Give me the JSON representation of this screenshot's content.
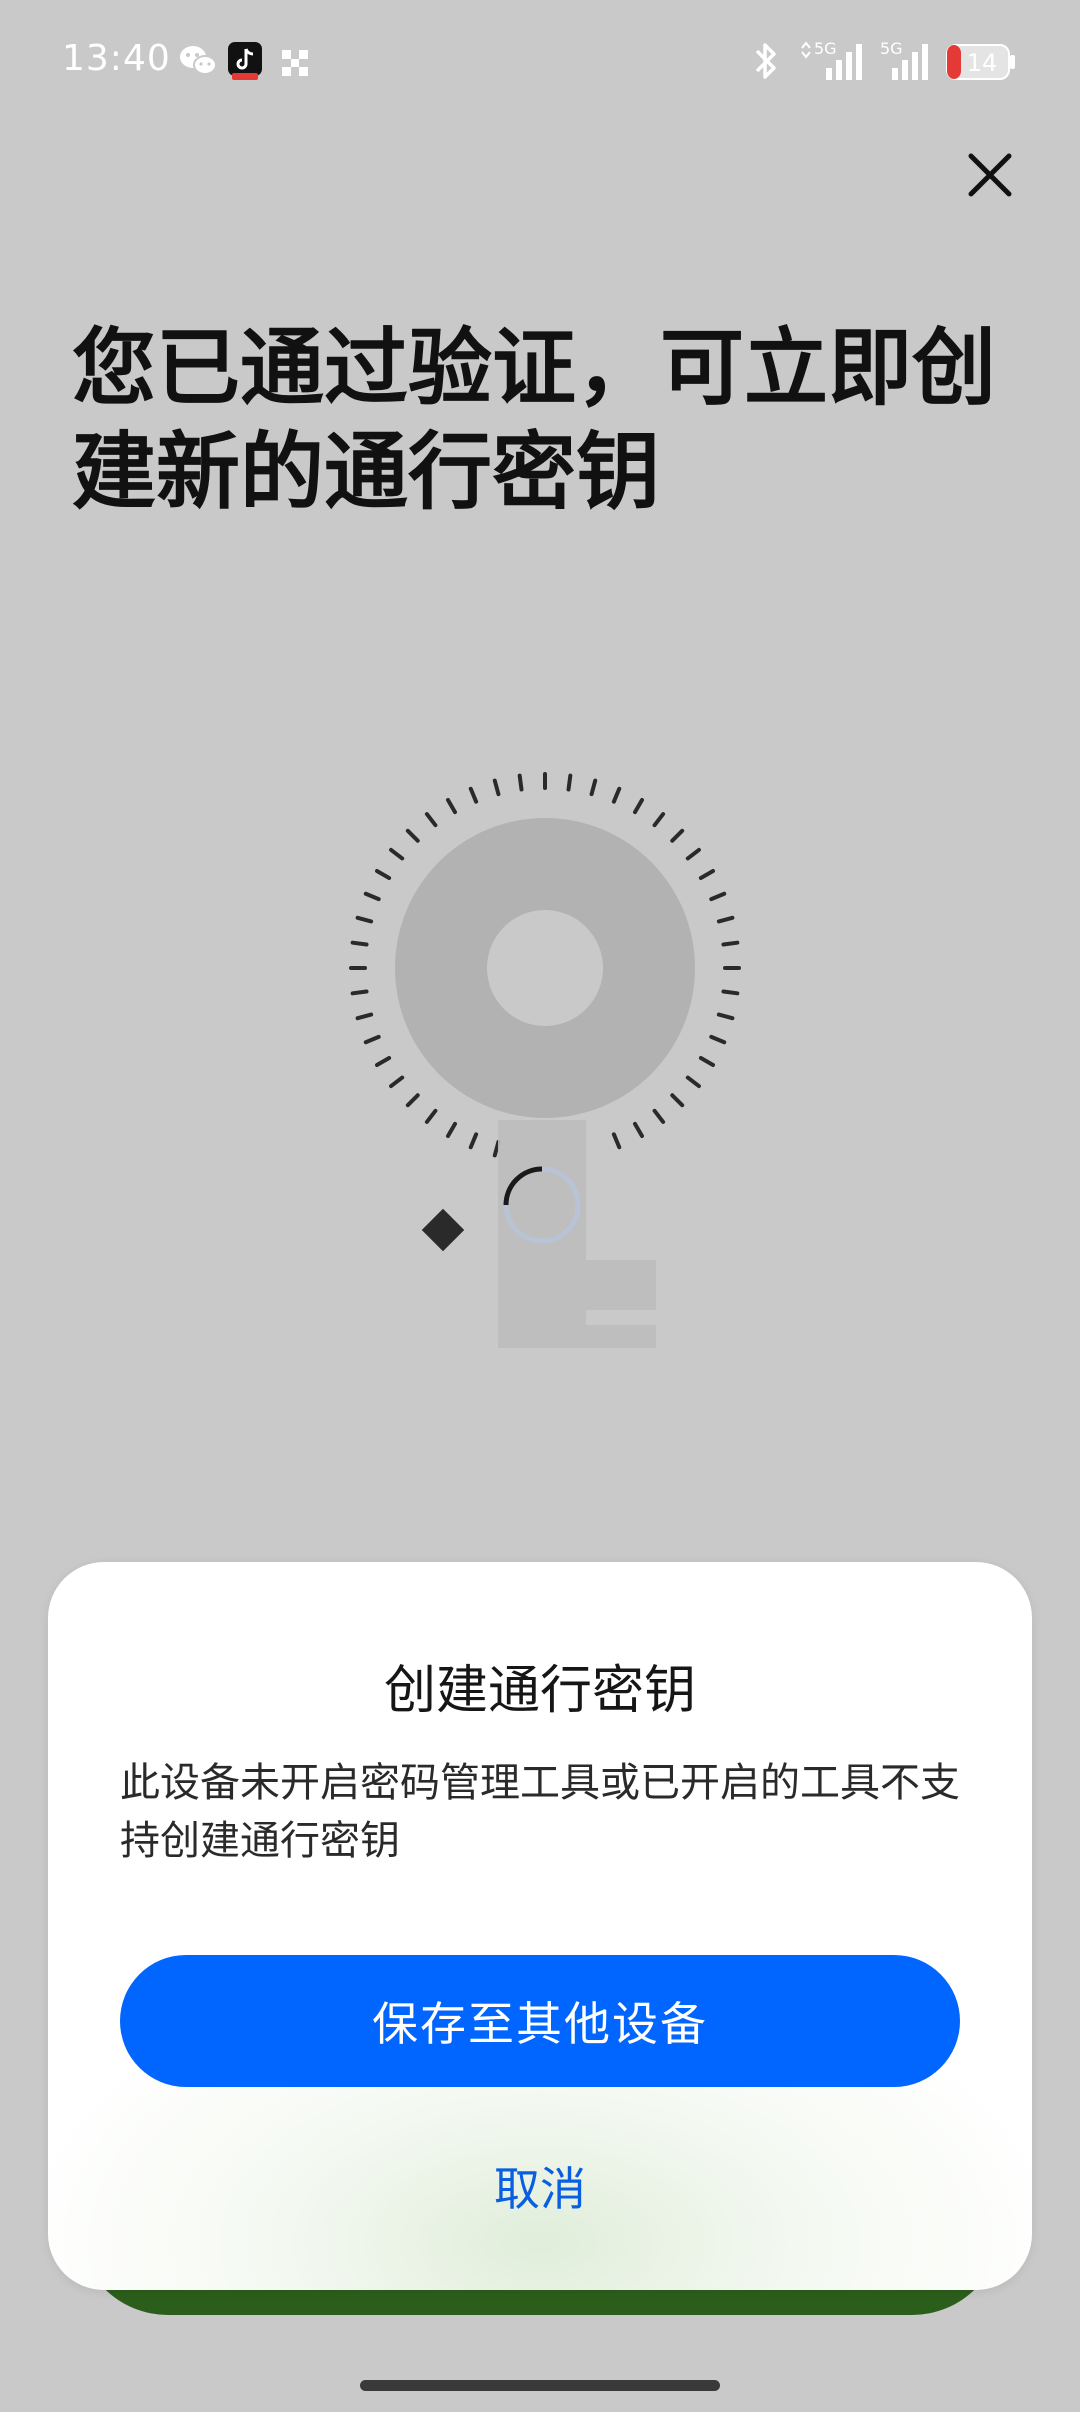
{
  "status_bar": {
    "time": "13:40",
    "battery_level": "14",
    "network_label_1": "5G",
    "network_label_2": "5G",
    "icons": [
      "wechat-icon",
      "tiktok-icon",
      "grid-app-icon",
      "bluetooth-icon",
      "signal-icon",
      "signal-icon",
      "battery-icon"
    ]
  },
  "page": {
    "headline": "您已通过验证，可立即创建新的通行密钥",
    "close_icon": "close-icon",
    "illustration_icon": "key-icon"
  },
  "dialog": {
    "title": "创建通行密钥",
    "body": "此设备未开启密码管理工具或已开启的工具不支持创建通行密钥",
    "primary_button": "保存至其他设备",
    "cancel_button": "取消"
  },
  "colors": {
    "background": "#c9c9c9",
    "primary": "#0066ff",
    "cancel_text": "#0a5fe0",
    "battery_low": "#e53935"
  }
}
